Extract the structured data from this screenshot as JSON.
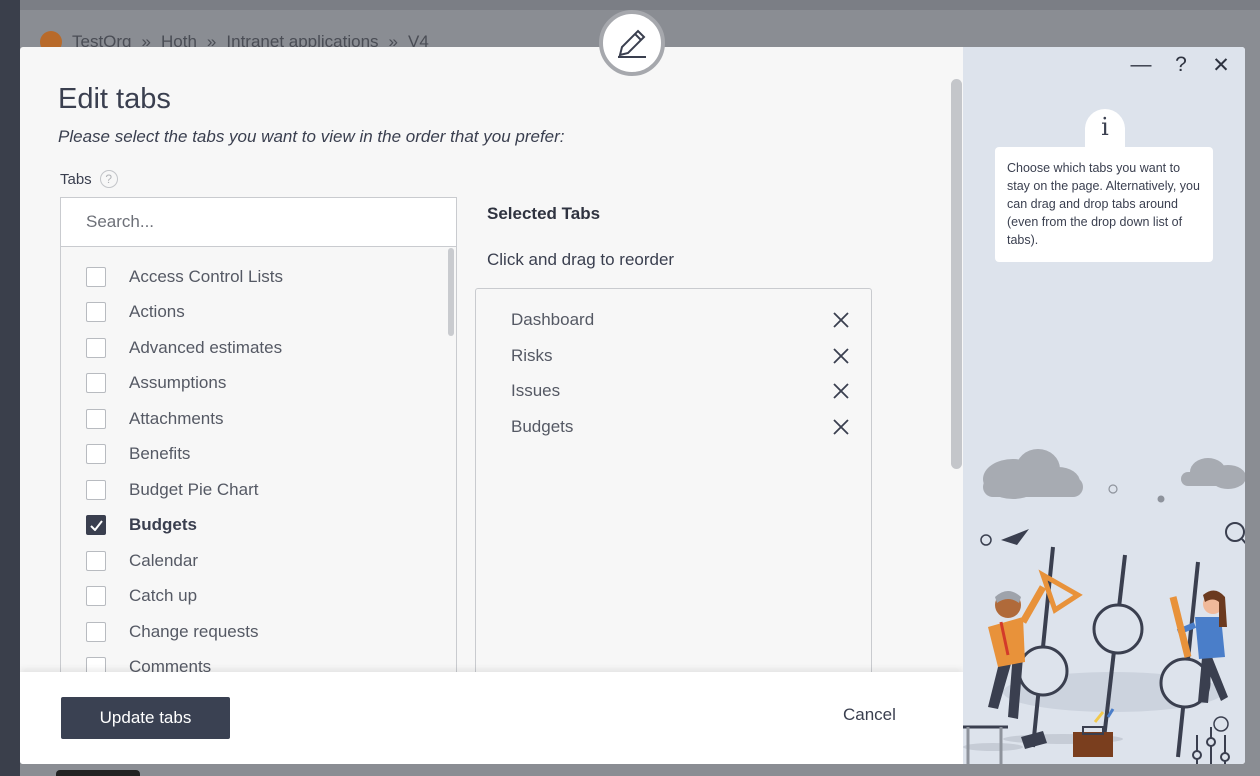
{
  "background": {
    "breadcrumb": [
      "TestOrg",
      "Hoth",
      "Intranet applications",
      "V4"
    ]
  },
  "modal": {
    "title": "Edit tabs",
    "subtitle": "Please select the tabs you want to view in the order that you prefer:",
    "tabs_label": "Tabs",
    "help_glyph": "?",
    "search_placeholder": "Search...",
    "tab_options": [
      {
        "label": "Access Control Lists",
        "checked": false
      },
      {
        "label": "Actions",
        "checked": false
      },
      {
        "label": "Advanced estimates",
        "checked": false
      },
      {
        "label": "Assumptions",
        "checked": false
      },
      {
        "label": "Attachments",
        "checked": false
      },
      {
        "label": "Benefits",
        "checked": false
      },
      {
        "label": "Budget Pie Chart",
        "checked": false
      },
      {
        "label": "Budgets",
        "checked": true
      },
      {
        "label": "Calendar",
        "checked": false
      },
      {
        "label": "Catch up",
        "checked": false
      },
      {
        "label": "Change requests",
        "checked": false
      },
      {
        "label": "Comments",
        "checked": false
      }
    ],
    "selected_title": "Selected Tabs",
    "selected_hint": "Click and drag to reorder",
    "selected_tabs": [
      "Dashboard",
      "Risks",
      "Issues",
      "Budgets"
    ],
    "update_button": "Update tabs",
    "cancel_button": "Cancel"
  },
  "side_panel": {
    "minimize_glyph": "—",
    "help_glyph": "?",
    "close_glyph": "✕",
    "info_glyph": "i",
    "info_text": "Choose which tabs you want to stay on the page. Alternatively, you can drag and drop tabs around (even from the drop down list of tabs)."
  },
  "colors": {
    "accent_dark": "#3a4152",
    "side_panel_bg": "#dde3ec",
    "orange": "#e8923a"
  },
  "icons": [
    "pencil-icon",
    "help-icon",
    "check-icon",
    "close-icon",
    "minimize-icon",
    "info-icon"
  ]
}
